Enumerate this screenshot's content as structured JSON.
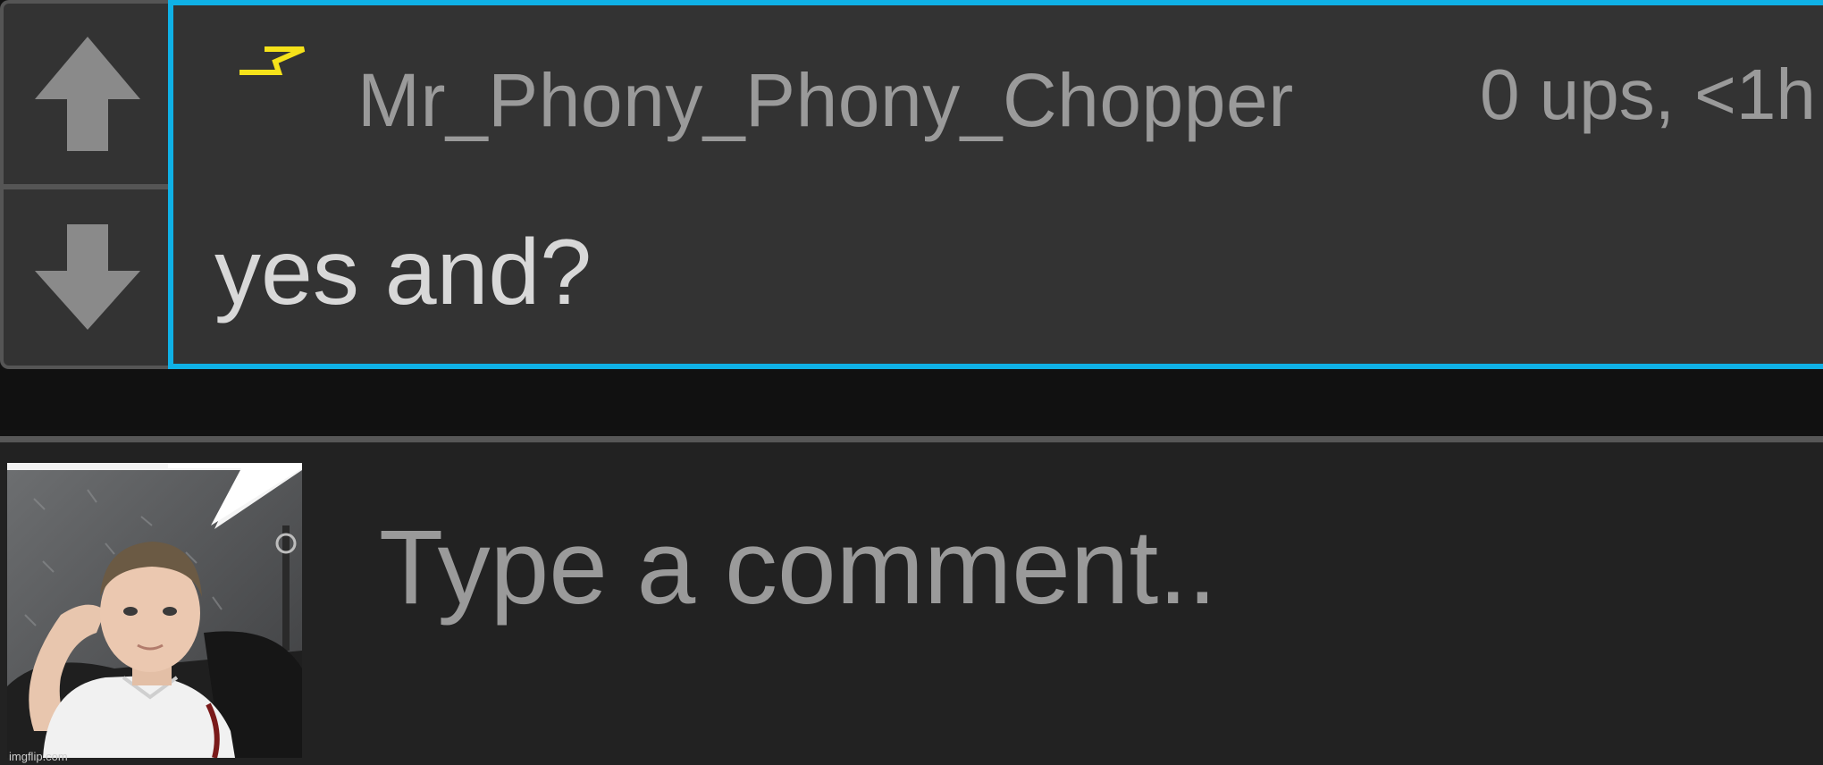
{
  "comment": {
    "author": "Mr_Phony_Phony_Chopper",
    "meta": "0 ups, <1h",
    "text": "yes and?",
    "flair_icon": "lightning-bolt-icon",
    "accent_color": "#0fb1e6",
    "flair_color": "#f5e21a"
  },
  "votes": {
    "upvote_icon": "arrow-up-icon",
    "downvote_icon": "arrow-down-icon"
  },
  "reply": {
    "placeholder": "Type a comment..",
    "avatar_watermark": "imgflip.com"
  }
}
